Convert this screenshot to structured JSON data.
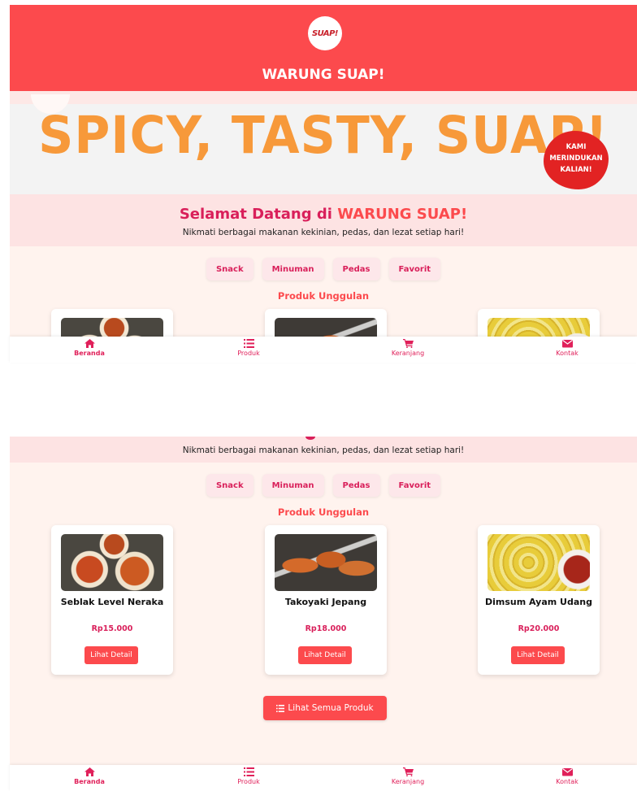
{
  "header": {
    "logo_text": "SUAP!",
    "title": "WARUNG SUAP!"
  },
  "banner": {
    "slogan": "SPICY, TASTY, SUAP!",
    "sticker": "KAMI MERINDUKAN KALIAN!"
  },
  "welcome": {
    "title_prefix": "Selamat Datang di",
    "title_brand": "WARUNG SUAP!",
    "subtitle": "Nikmati berbagai makanan kekinian, pedas, dan lezat setiap hari!"
  },
  "categories": [
    "Snack",
    "Minuman",
    "Pedas",
    "Favorit"
  ],
  "featured_title": "Produk Unggulan",
  "products": [
    {
      "name": "Seblak Level Neraka",
      "price": "Rp15.000",
      "button": "Lihat Detail",
      "image": "seblak-photo"
    },
    {
      "name": "Takoyaki Jepang",
      "price": "Rp18.000",
      "button": "Lihat Detail",
      "image": "takoyaki-photo"
    },
    {
      "name": "Dimsum Ayam Udang",
      "price": "Rp20.000",
      "button": "Lihat Detail",
      "image": "dimsum-photo"
    }
  ],
  "all_products_button": "Lihat Semua Produk",
  "nav": [
    {
      "label": "Beranda",
      "icon": "home-icon"
    },
    {
      "label": "Produk",
      "icon": "list-icon"
    },
    {
      "label": "Keranjang",
      "icon": "cart-icon"
    },
    {
      "label": "Kontak",
      "icon": "mail-icon"
    }
  ],
  "colors": {
    "primary": "#fc4a4d",
    "accent": "#d91f5a",
    "slogan": "#f7993a",
    "background": "#fff3ee"
  }
}
